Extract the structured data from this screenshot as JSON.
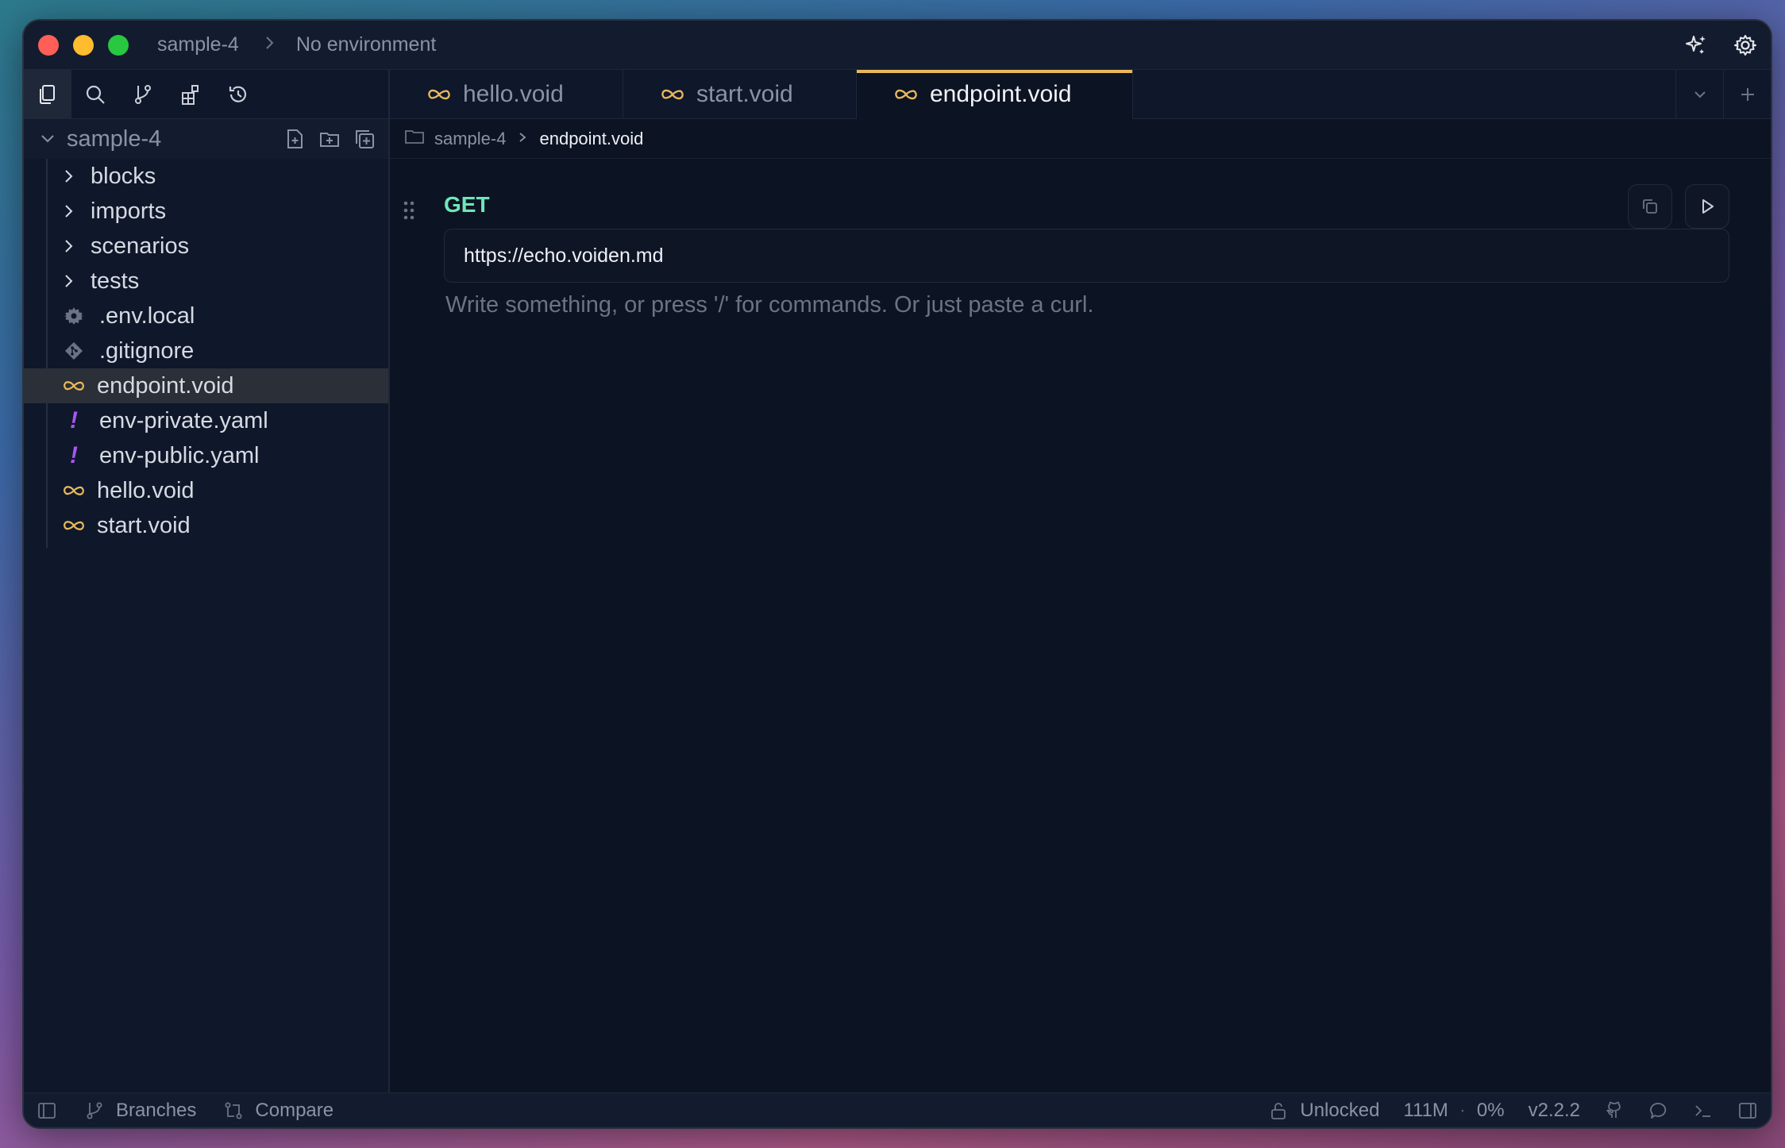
{
  "titlebar": {
    "project": "sample-4",
    "environment": "No environment"
  },
  "sidebar": {
    "project_name": "sample-4",
    "folders": [
      "blocks",
      "imports",
      "scenarios",
      "tests"
    ],
    "files": [
      {
        "name": ".env.local",
        "icon": "gear-icon"
      },
      {
        "name": ".gitignore",
        "icon": "git-icon"
      },
      {
        "name": "endpoint.void",
        "icon": "void-infinity-icon",
        "selected": true
      },
      {
        "name": "env-private.yaml",
        "icon": "yaml-bang-icon"
      },
      {
        "name": "env-public.yaml",
        "icon": "yaml-bang-icon"
      },
      {
        "name": "hello.void",
        "icon": "void-infinity-icon"
      },
      {
        "name": "start.void",
        "icon": "void-infinity-icon"
      }
    ],
    "yaml_glyph": "!"
  },
  "tabs": [
    {
      "label": "hello.void",
      "active": false
    },
    {
      "label": "start.void",
      "active": false
    },
    {
      "label": "endpoint.void",
      "active": true
    }
  ],
  "breadcrumb": {
    "project": "sample-4",
    "file": "endpoint.void"
  },
  "request": {
    "method": "GET",
    "url": "https://echo.voiden.md"
  },
  "editor": {
    "placeholder": "Write something, or press '/' for commands. Or just paste a curl."
  },
  "statusbar": {
    "branches": "Branches",
    "compare": "Compare",
    "lock_status": "Unlocked",
    "memory": "111M",
    "separator": "·",
    "cpu": "0%",
    "version": "v2.2.2"
  },
  "colors": {
    "accent_tab": "#e8b85a",
    "void_icon": "#e8b85a",
    "method_get": "#6ee7b7",
    "yaml_icon": "#a855f7"
  }
}
